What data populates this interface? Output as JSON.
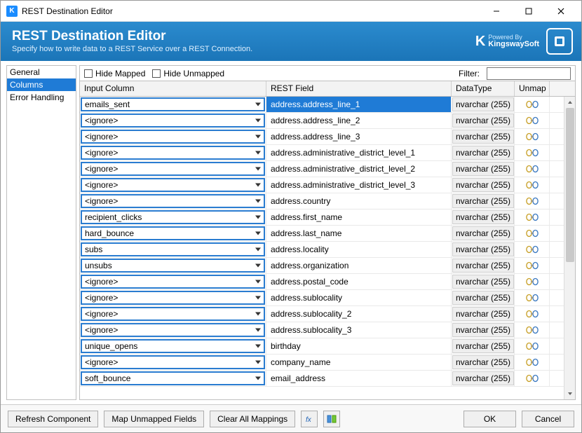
{
  "window": {
    "title": "REST Destination Editor",
    "icon_letter": "K"
  },
  "header": {
    "title": "REST Destination Editor",
    "subtitle": "Specify how to write data to a REST Service over a REST Connection.",
    "brand_powered": "Powered By",
    "brand_name": "KingswaySoft"
  },
  "sidebar": {
    "items": [
      {
        "label": "General"
      },
      {
        "label": "Columns",
        "selected": true
      },
      {
        "label": "Error Handling"
      }
    ]
  },
  "toolbar": {
    "hide_mapped": "Hide Mapped",
    "hide_unmapped": "Hide Unmapped",
    "filter_label": "Filter:",
    "filter_value": ""
  },
  "table": {
    "headers": {
      "input": "Input Column",
      "rest": "REST Field",
      "type": "DataType",
      "unmap": "Unmap"
    },
    "rows": [
      {
        "input": "emails_sent",
        "rest": "address.address_line_1",
        "type": "nvarchar (255)",
        "selected": true
      },
      {
        "input": "<ignore>",
        "rest": "address.address_line_2",
        "type": "nvarchar (255)"
      },
      {
        "input": "<ignore>",
        "rest": "address.address_line_3",
        "type": "nvarchar (255)"
      },
      {
        "input": "<ignore>",
        "rest": "address.administrative_district_level_1",
        "type": "nvarchar (255)"
      },
      {
        "input": "<ignore>",
        "rest": "address.administrative_district_level_2",
        "type": "nvarchar (255)"
      },
      {
        "input": "<ignore>",
        "rest": "address.administrative_district_level_3",
        "type": "nvarchar (255)"
      },
      {
        "input": "<ignore>",
        "rest": "address.country",
        "type": "nvarchar (255)"
      },
      {
        "input": "recipient_clicks",
        "rest": "address.first_name",
        "type": "nvarchar (255)"
      },
      {
        "input": "hard_bounce",
        "rest": "address.last_name",
        "type": "nvarchar (255)"
      },
      {
        "input": "subs",
        "rest": "address.locality",
        "type": "nvarchar (255)"
      },
      {
        "input": "unsubs",
        "rest": "address.organization",
        "type": "nvarchar (255)"
      },
      {
        "input": "<ignore>",
        "rest": "address.postal_code",
        "type": "nvarchar (255)"
      },
      {
        "input": "<ignore>",
        "rest": "address.sublocality",
        "type": "nvarchar (255)"
      },
      {
        "input": "<ignore>",
        "rest": "address.sublocality_2",
        "type": "nvarchar (255)"
      },
      {
        "input": "<ignore>",
        "rest": "address.sublocality_3",
        "type": "nvarchar (255)"
      },
      {
        "input": "unique_opens",
        "rest": "birthday",
        "type": "nvarchar (255)"
      },
      {
        "input": "<ignore>",
        "rest": "company_name",
        "type": "nvarchar (255)"
      },
      {
        "input": "soft_bounce",
        "rest": "email_address",
        "type": "nvarchar (255)"
      }
    ]
  },
  "footer": {
    "refresh": "Refresh Component",
    "map_unmapped": "Map Unmapped Fields",
    "clear_all": "Clear All Mappings",
    "ok": "OK",
    "cancel": "Cancel"
  }
}
